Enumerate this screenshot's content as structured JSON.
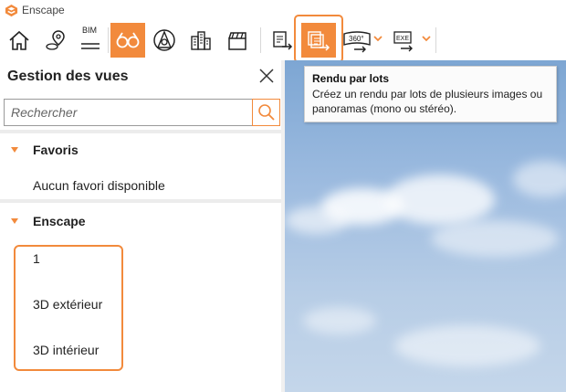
{
  "window": {
    "title": "Enscape",
    "accent_color": "#f28a3c"
  },
  "toolbar": {
    "buttons": [
      {
        "name": "home-icon",
        "label": ""
      },
      {
        "name": "map-pin-icon",
        "label": ""
      },
      {
        "name": "bim-icon",
        "label": "BIM"
      },
      {
        "name": "views-binoculars-icon",
        "label": "",
        "active": true
      },
      {
        "name": "navigation-icon",
        "label": ""
      },
      {
        "name": "buildings-icon",
        "label": ""
      },
      {
        "name": "video-clapper-icon",
        "label": ""
      },
      {
        "name": "render-image-icon",
        "label": ""
      },
      {
        "name": "batch-render-icon",
        "label": "",
        "highlighted": true
      },
      {
        "name": "panorama-360-icon",
        "label": "360°"
      },
      {
        "name": "export-exe-icon",
        "label": "EXE"
      }
    ]
  },
  "tooltip": {
    "title": "Rendu par lots",
    "description": "Créez un rendu par lots de plusieurs images ou panoramas (mono ou stéréo)."
  },
  "panel": {
    "title": "Gestion des vues",
    "search_placeholder": "Rechercher",
    "sections": [
      {
        "title": "Favoris",
        "empty_text": "Aucun favori disponible",
        "items": []
      },
      {
        "title": "Enscape",
        "items": [
          "1",
          "3D extérieur",
          "3D intérieur"
        ]
      }
    ]
  }
}
